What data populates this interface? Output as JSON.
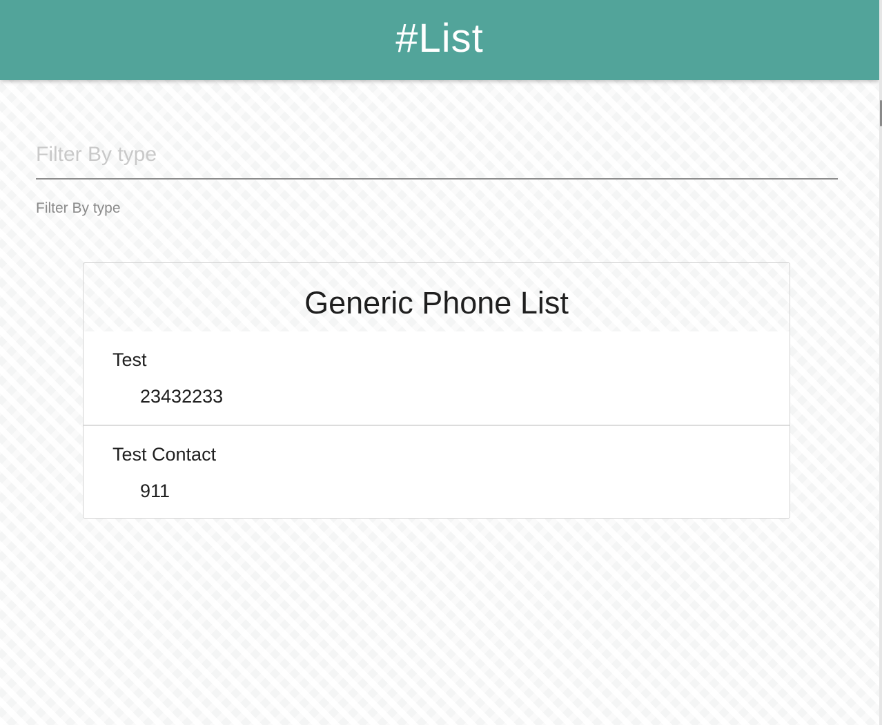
{
  "header": {
    "title": "#List",
    "background_color": "#52a49a"
  },
  "filter": {
    "placeholder": "Filter By type",
    "value": "",
    "helper_text": "Filter By type"
  },
  "card": {
    "title": "Generic Phone List",
    "contacts": [
      {
        "name": "Test",
        "phone": "23432233"
      },
      {
        "name": "Test Contact",
        "phone": "911"
      }
    ]
  }
}
